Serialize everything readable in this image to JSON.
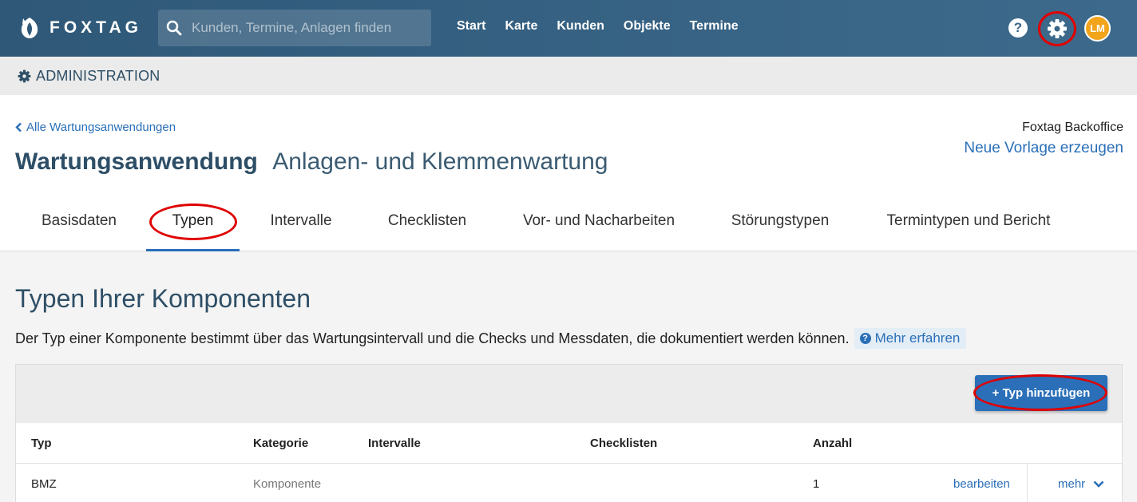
{
  "brand": {
    "name": "FOXTAG"
  },
  "search": {
    "placeholder": "Kunden, Termine, Anlagen finden"
  },
  "nav": {
    "items": [
      "Start",
      "Karte",
      "Kunden",
      "Objekte",
      "Termine"
    ]
  },
  "user": {
    "initials": "LM"
  },
  "admin": {
    "label": "ADMINISTRATION"
  },
  "header": {
    "back_label": "Alle Wartungsanwendungen",
    "title_main": "Wartungsanwendung",
    "title_sub": "Anlagen- und Klemmenwartung",
    "owner_name": "Foxtag Backoffice",
    "template_link": "Neue Vorlage erzeugen"
  },
  "tabs": [
    "Basisdaten",
    "Typen",
    "Intervalle",
    "Checklisten",
    "Vor- und Nacharbeiten",
    "Störungstypen",
    "Termintypen und Bericht"
  ],
  "active_tab": "Typen",
  "section": {
    "title": "Typen Ihrer Komponenten",
    "description": "Der Typ einer Komponente bestimmt über das Wartungsintervall und die Checks und Messdaten, die dokumentiert werden können.",
    "more_label": "Mehr erfahren"
  },
  "table": {
    "add_label": "+ Typ hinzufügen",
    "headers": [
      "Typ",
      "Kategorie",
      "Intervalle",
      "Checklisten",
      "Anzahl"
    ],
    "rows": [
      {
        "typ": "BMZ",
        "kategorie": "Komponente",
        "intervalle": "",
        "checklisten": "",
        "anzahl": "1",
        "edit": "bearbeiten",
        "more": "mehr"
      }
    ]
  },
  "colors": {
    "accent": "#2a6fb8",
    "header_bg": "#3a6586",
    "highlight": "#e00000",
    "avatar": "#f2a41b"
  }
}
